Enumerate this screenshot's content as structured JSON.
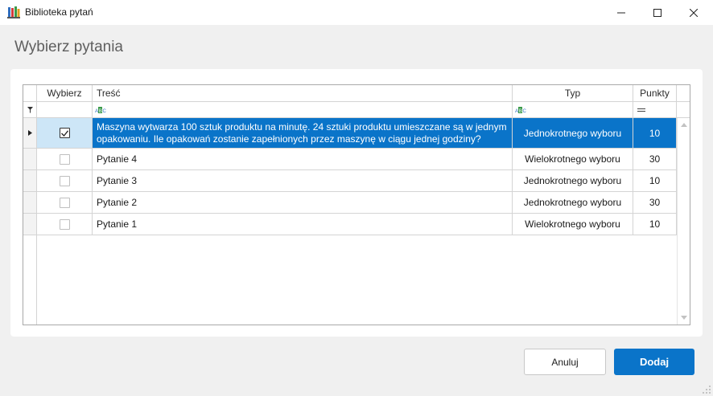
{
  "window": {
    "title": "Biblioteka pytań",
    "icon": "app-library-icon",
    "controls": [
      "minimize-icon",
      "maximize-icon",
      "close-icon"
    ]
  },
  "header": {
    "title": "Wybierz pytania"
  },
  "grid": {
    "columns": {
      "select": "Wybierz",
      "content": "Treść",
      "type": "Typ",
      "points": "Punkty"
    },
    "filter_icons": {
      "row": "funnel-filter-icon",
      "content": "text-filter-icon",
      "type": "text-filter-icon",
      "points": "equals-filter-icon"
    },
    "rows": [
      {
        "selected": true,
        "checked": true,
        "content": "Maszyna wytwarza 100 sztuk produktu na minutę. 24 sztuki produktu umieszczane są w jednym opakowaniu. Ile opakowań zostanie zapełnionych przez maszynę w ciągu jednej godziny?",
        "type": "Jednokrotnego wyboru",
        "points": "10"
      },
      {
        "selected": false,
        "checked": false,
        "content": "Pytanie 4",
        "type": "Wielokrotnego wyboru",
        "points": "30"
      },
      {
        "selected": false,
        "checked": false,
        "content": "Pytanie 3",
        "type": "Jednokrotnego wyboru",
        "points": "10"
      },
      {
        "selected": false,
        "checked": false,
        "content": "Pytanie 2",
        "type": "Jednokrotnego wyboru",
        "points": "30"
      },
      {
        "selected": false,
        "checked": false,
        "content": "Pytanie 1",
        "type": "Wielokrotnego wyboru",
        "points": "10"
      }
    ]
  },
  "buttons": {
    "cancel": "Anuluj",
    "add": "Dodaj"
  },
  "colors": {
    "accent": "#0a74c9",
    "selected_check_bg": "#cde6f7"
  }
}
